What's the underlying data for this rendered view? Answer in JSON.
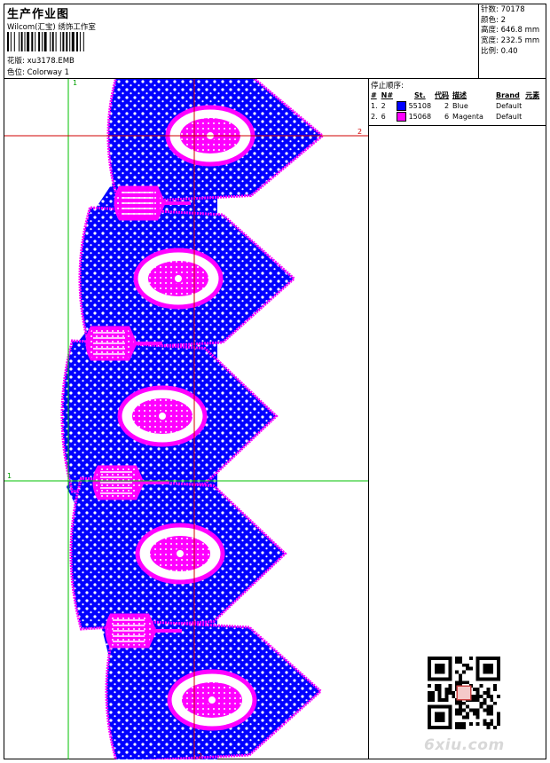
{
  "header": {
    "title": "生产作业图",
    "subtitle": "Wilcom(汇宝) 绣饰工作室",
    "design_label": "花版:",
    "design_value": "xu3178.EMB",
    "colorway_label": "色位:",
    "colorway_value": "Colorway 1"
  },
  "stats": [
    {
      "label": "针数:",
      "value": "70178"
    },
    {
      "label": "颜色:",
      "value": "2"
    },
    {
      "label": "高度:",
      "value": "646.8 mm"
    },
    {
      "label": "宽度:",
      "value": "232.5 mm"
    },
    {
      "label": "比例:",
      "value": "0.40"
    }
  ],
  "stop_sequence": {
    "title": "停止顺序:",
    "columns": [
      "#",
      "N#",
      "St.",
      "代码",
      "描述",
      "Brand",
      "元素"
    ],
    "rows": [
      {
        "num": "1.",
        "needle": "2",
        "stitches": "55108",
        "code": "2",
        "desc": "Blue",
        "brand": "Default",
        "color": "#0000ff"
      },
      {
        "num": "2.",
        "needle": "6",
        "stitches": "15068",
        "code": "6",
        "desc": "Magenta",
        "brand": "Default",
        "color": "#ff00ff"
      }
    ]
  },
  "markers": {
    "v1": "1",
    "v2": "2",
    "h1": "1",
    "h2": "2"
  },
  "colors": {
    "thread_blue": "#0000ff",
    "thread_magenta": "#ff00ff",
    "guide_green": "#00c000",
    "guide_red": "#d00000"
  },
  "watermark": "6xiu.com"
}
